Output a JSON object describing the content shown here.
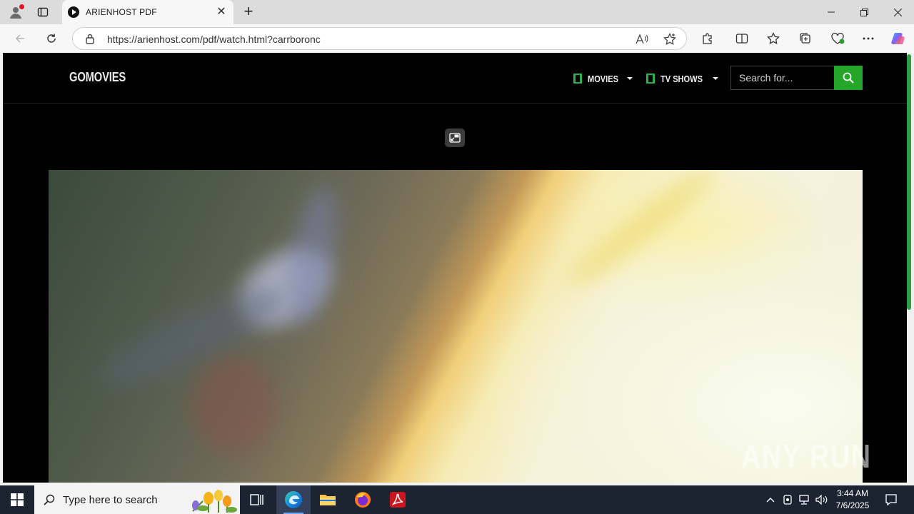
{
  "browser": {
    "tab_title": "ARIENHOST PDF",
    "url": "https://arienhost.com/pdf/watch.html?carrboronc"
  },
  "site": {
    "logo": "GOMOVIES",
    "nav": [
      {
        "label": "MOVIES"
      },
      {
        "label": "TV SHOWS"
      }
    ],
    "search_placeholder": "Search for..."
  },
  "video": {
    "watermark": "ANY RUN"
  },
  "taskbar": {
    "search_placeholder": "Type here to search",
    "time": "3:44 AM",
    "date": "7/6/2025"
  },
  "colors": {
    "accent_green": "#24a628",
    "nav_icon_green": "#2bb34a",
    "taskbar_bg": "#1c2432",
    "page_bg": "#000000"
  }
}
